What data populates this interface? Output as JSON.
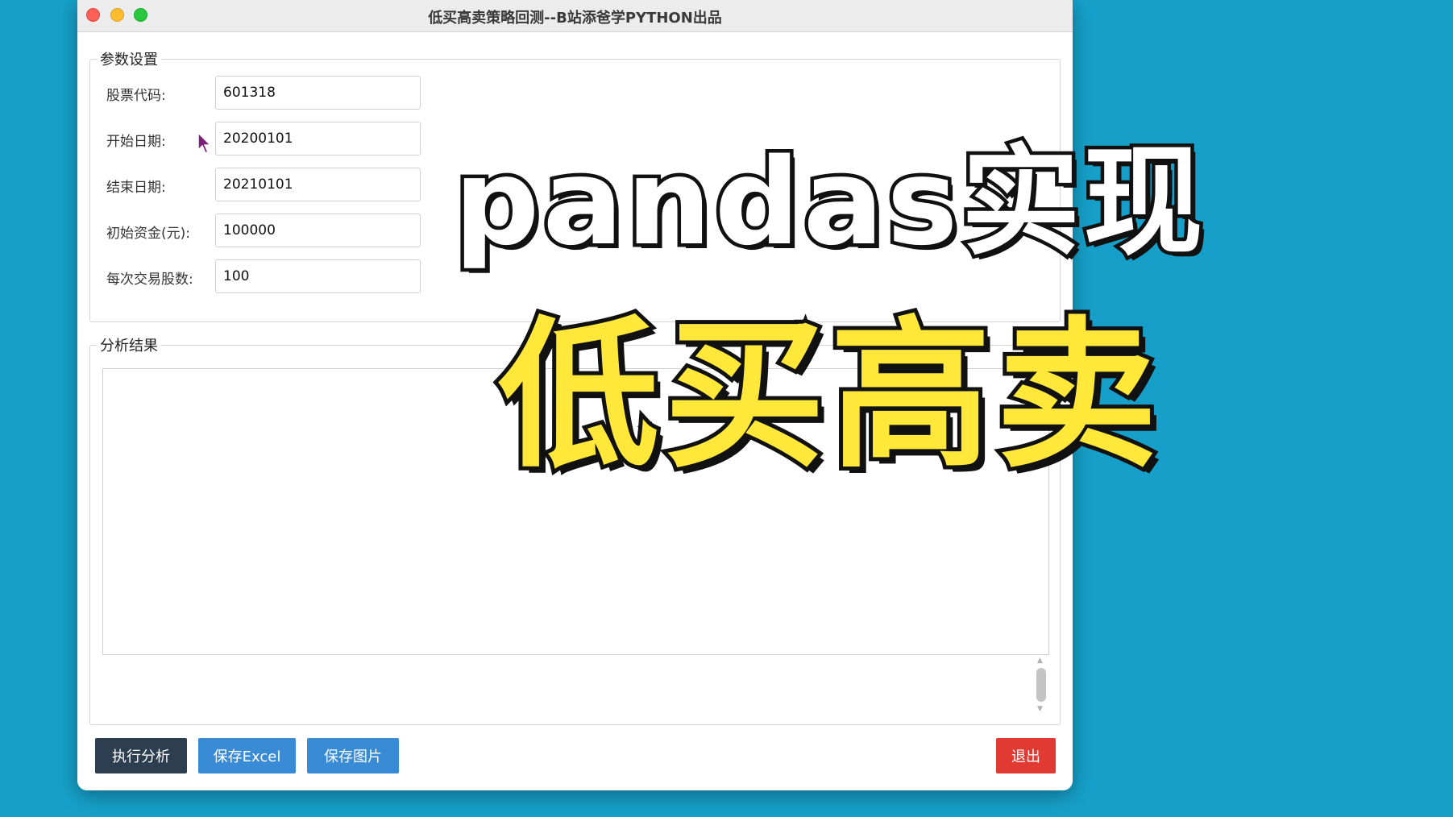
{
  "window": {
    "title": "低买高卖策略回测--B站添爸学PYTHON出品"
  },
  "params_group": {
    "label": "参数设置",
    "fields": [
      {
        "label": "股票代码:",
        "value": "601318"
      },
      {
        "label": "开始日期:",
        "value": "20200101"
      },
      {
        "label": "结束日期:",
        "value": "20210101"
      },
      {
        "label": "初始资金(元):",
        "value": "100000"
      },
      {
        "label": "每次交易股数:",
        "value": "100"
      }
    ]
  },
  "results_group": {
    "label": "分析结果",
    "text": ""
  },
  "buttons": {
    "run": "执行分析",
    "save_excel": "保存Excel",
    "save_image": "保存图片",
    "exit": "退出"
  },
  "overlay": {
    "line1": "pandas实现",
    "line2": "低买高卖"
  },
  "colors": {
    "desktop": "#16a0c9",
    "run_button": "#2c3e50",
    "save_button": "#3a8bd6",
    "exit_button": "#e03a32",
    "overlay_line2": "#ffe83a"
  }
}
